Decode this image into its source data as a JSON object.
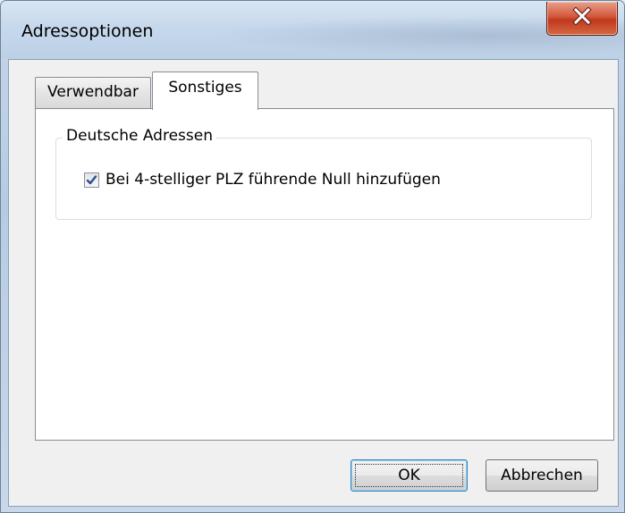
{
  "window": {
    "title": "Adressoptionen",
    "close_icon": "close-x-icon"
  },
  "tabs": [
    {
      "label": "Verwendbar",
      "active": false
    },
    {
      "label": "Sonstiges",
      "active": true
    }
  ],
  "panel": {
    "group_label": "Deutsche Adressen",
    "checkbox": {
      "label": "Bei 4-stelliger PLZ führende Null hinzufügen",
      "checked": true
    }
  },
  "buttons": {
    "ok_label": "OK",
    "cancel_label": "Abbrechen"
  },
  "colors": {
    "titlebar": "#c6d8ec",
    "close_button": "#c0381c",
    "check_mark": "#2b4f8c"
  }
}
